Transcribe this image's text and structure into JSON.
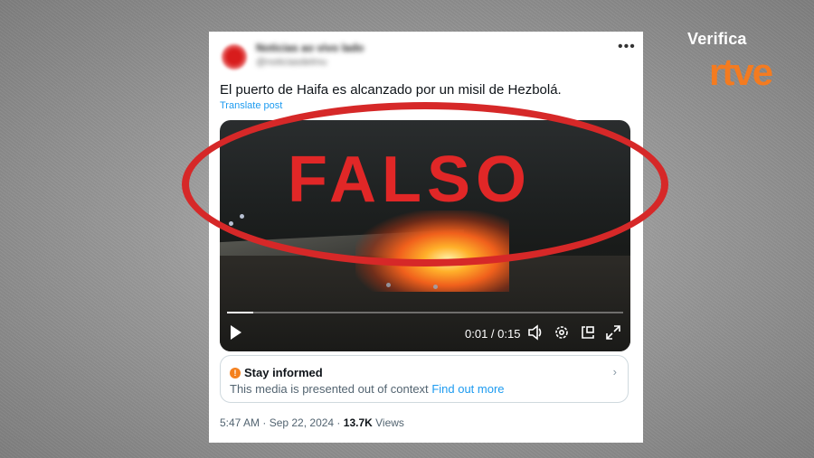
{
  "brand": {
    "verifica": "Verifica",
    "logo": "rtve",
    "logo_color": "#f47b20"
  },
  "tweet": {
    "author_name": "Noticias ao vivo lado",
    "author_handle": "@noticiasdelmu",
    "more_icon": "more-icon",
    "text": "El puerto de Haifa es alcanzado por un misil de Hezbolá.",
    "translate_link": "Translate post"
  },
  "video": {
    "progress": 0.067,
    "time": "0:01 / 0:15",
    "controls": [
      "play-icon",
      "volume-icon",
      "settings-icon",
      "picture-in-picture-icon",
      "fullscreen-icon"
    ]
  },
  "notice": {
    "title": "Stay informed",
    "body": "This media is presented out of context",
    "link": "Find out more",
    "accent": "#f4811f"
  },
  "meta": {
    "timestamp": "5:47 AM · Sep 22, 2024 · ",
    "views_count": "13.7K",
    "views_label": " Views"
  },
  "stamp": {
    "text": "FALSO",
    "color": "#e12727"
  }
}
